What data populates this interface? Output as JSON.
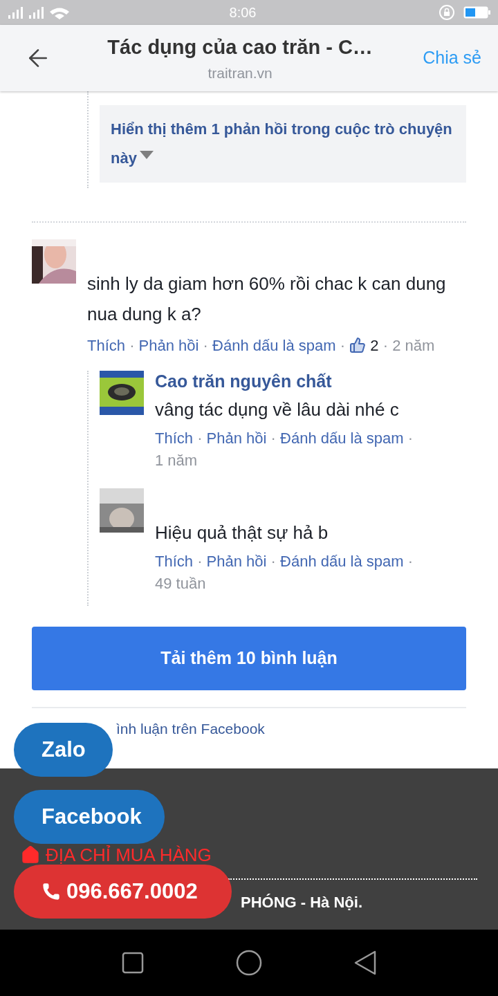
{
  "status_bar": {
    "time": "8:06"
  },
  "header": {
    "title": "Tác dụng của cao trăn - C…",
    "subtitle": "traitran.vn",
    "share": "Chia sẻ"
  },
  "separator": "·",
  "more_replies": {
    "text": "Hiển thị thêm 1 phản hồi trong cuộc trò chuyện này"
  },
  "comments": [
    {
      "text": "sinh ly da giam hơn 60% rồi chac k can dung nua dung k a?",
      "actions": [
        "Thích",
        "Phản hồi",
        "Đánh dấu là spam"
      ],
      "likes": "2",
      "time": "2 năm",
      "replies": [
        {
          "author": "Cao trăn nguyên chất",
          "text": "vâng tác dụng về lâu dài nhé c",
          "actions": [
            "Thích",
            "Phản hồi",
            "Đánh dấu là spam"
          ],
          "time": "1 năm"
        },
        {
          "text": "Hiệu quả thật sự hả b",
          "actions": [
            "Thích",
            "Phản hồi",
            "Đánh dấu là spam"
          ],
          "time": "49 tuần"
        }
      ]
    }
  ],
  "load_more": "Tải thêm 10 bình luận",
  "plugin_note": "ình luận trên Facebook",
  "footer": {
    "heading": "ĐỊA CHỈ MUA HÀNG",
    "address": "PHÓNG - Hà Nội."
  },
  "floating_buttons": [
    {
      "kind": "zalo",
      "label": "Zalo"
    },
    {
      "kind": "facebook",
      "label": "Facebook"
    },
    {
      "kind": "phone",
      "label": "096.667.0002"
    }
  ]
}
